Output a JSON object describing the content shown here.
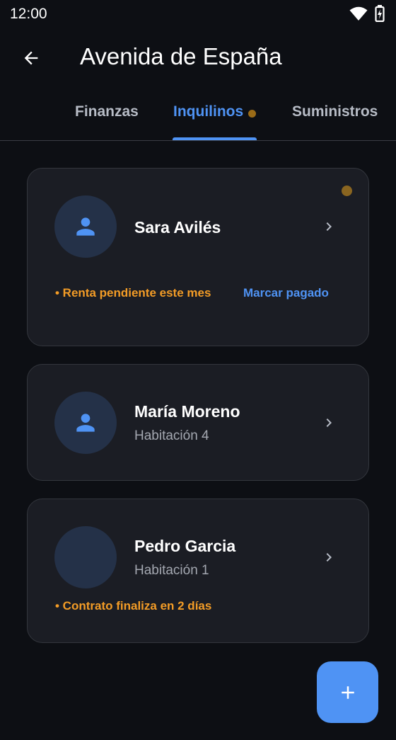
{
  "status_bar": {
    "time": "12:00"
  },
  "app_bar": {
    "title": "Avenida de España",
    "back_icon": "arrow-back-icon"
  },
  "tabs": [
    {
      "label": "Finanzas",
      "selected": false
    },
    {
      "label": "Inquilinos",
      "selected": true,
      "has_notification": true
    },
    {
      "label": "Suministros",
      "selected": false
    }
  ],
  "tenants": [
    {
      "name": "Sara Avilés",
      "room": "",
      "has_avatar_icon": true,
      "has_notification": true,
      "alert": "• Renta pendiente este mes",
      "action": "Marcar pagado"
    },
    {
      "name": "María Moreno",
      "room": "Habitación 4",
      "has_avatar_icon": true,
      "alert": ""
    },
    {
      "name": "Pedro Garcia",
      "room": "Habitación 1",
      "has_avatar_icon": false,
      "alert": "• Contrato finaliza en 2 días"
    }
  ],
  "fab": {
    "icon": "add-icon"
  },
  "colors": {
    "background": "#0d0f14",
    "card": "#1b1d24",
    "accent": "#4f93f4",
    "warning": "#f39c26",
    "notification_dot": "#9a6b17",
    "avatar_bg": "#243148"
  }
}
